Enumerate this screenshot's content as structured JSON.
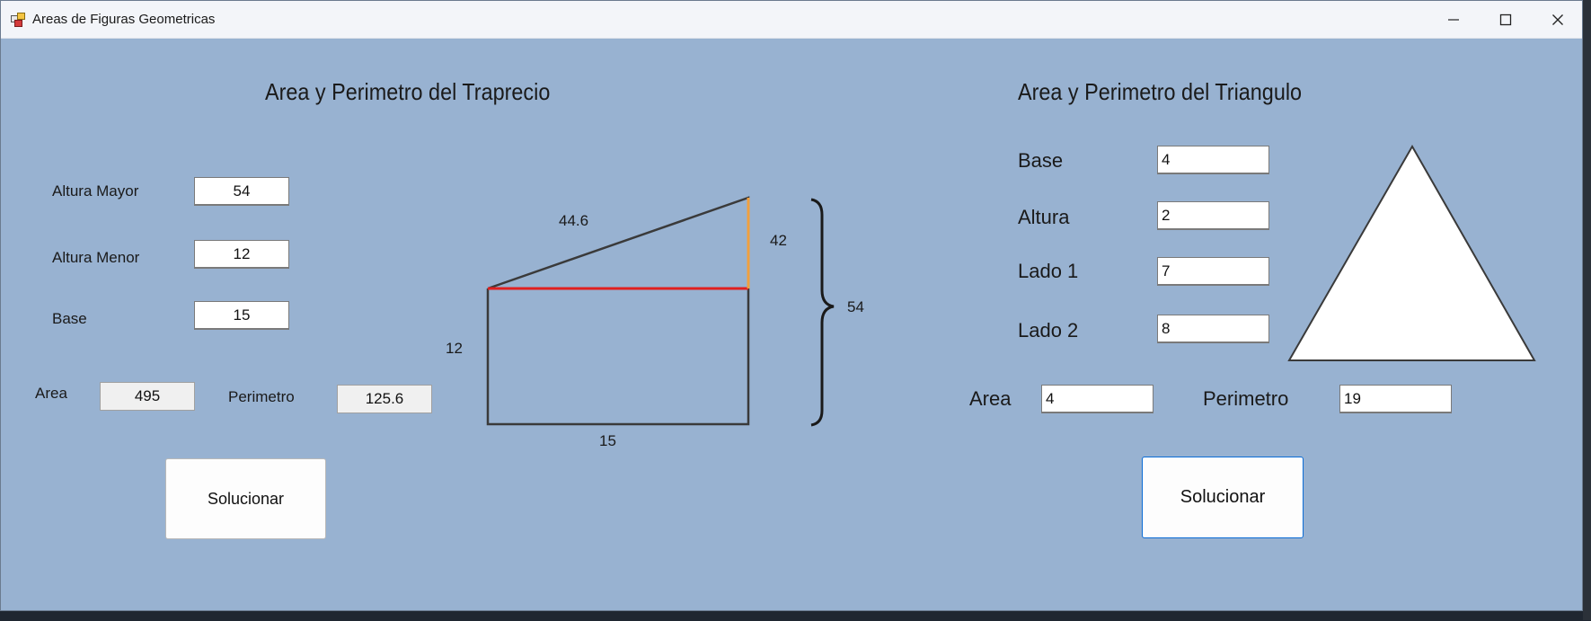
{
  "window": {
    "title": "Areas de Figuras Geometricas",
    "controls": [
      "minimize-icon",
      "maximize-icon",
      "close-icon"
    ]
  },
  "trapecio": {
    "heading": "Area y Perimetro del Traprecio",
    "altura_mayor_label": "Altura Mayor",
    "altura_mayor_value": "54",
    "altura_menor_label": "Altura Menor",
    "altura_menor_value": "12",
    "base_label": "Base",
    "base_value": "15",
    "area_label": "Area",
    "area_value": "495",
    "perimetro_label": "Perimetro",
    "perimetro_value": "125.6",
    "solve_label": "Solucionar",
    "diagram": {
      "hyp_label": "44.6",
      "right_upper_label": "42",
      "left_label": "12",
      "bottom_label": "15",
      "total_height_label": "54",
      "colors": {
        "outline": "#3a3a3a",
        "red_line": "#e02020",
        "orange_line": "#f0a040"
      }
    }
  },
  "triangulo": {
    "heading": "Area y Perimetro del Triangulo",
    "base_label": "Base",
    "base_value": "4",
    "altura_label": "Altura",
    "altura_value": "2",
    "lado1_label": "Lado 1",
    "lado1_value": "7",
    "lado2_label": "Lado 2",
    "lado2_value": "8",
    "area_label": "Area",
    "area_value": "4",
    "perimetro_label": "Perimetro",
    "perimetro_value": "19",
    "solve_label": "Solucionar"
  },
  "colors": {
    "form_background": "#98b2d1",
    "focus_border": "#0a6cd6"
  }
}
